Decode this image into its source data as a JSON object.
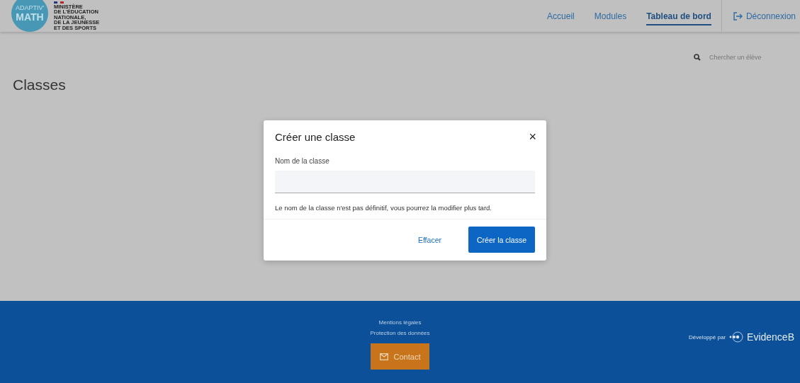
{
  "header": {
    "logo": {
      "top": "ADAPTIV'",
      "bottom": "MATH"
    },
    "ministry": [
      "MINISTÈRE",
      "DE L'ÉDUCATION",
      "NATIONALE,",
      "DE LA JEUNESSE",
      "ET DES SPORTS"
    ],
    "nav": [
      {
        "label": "Accueil",
        "selected": false
      },
      {
        "label": "Modules",
        "selected": false
      },
      {
        "label": "Tableau de bord",
        "selected": true
      }
    ],
    "logout": "Déconnexion"
  },
  "search": {
    "placeholder": "Chercher un élève"
  },
  "page_title": "Classes",
  "dialog": {
    "title": "Créer une classe",
    "close": "×",
    "field_label": "Nom de la classe",
    "hint": "Le nom de la classe n'est pas définitif, vous pourrez la modifier plus tard.",
    "buttons": [
      {
        "label": "Effacer",
        "kind": "text"
      },
      {
        "label": "Créer la classe",
        "kind": "primary"
      }
    ]
  },
  "footer": {
    "links": [
      "Mentions légales",
      "Protection des données"
    ],
    "contact": "Contact",
    "developed_by": "Développé par",
    "brand": "EvidenceB"
  }
}
